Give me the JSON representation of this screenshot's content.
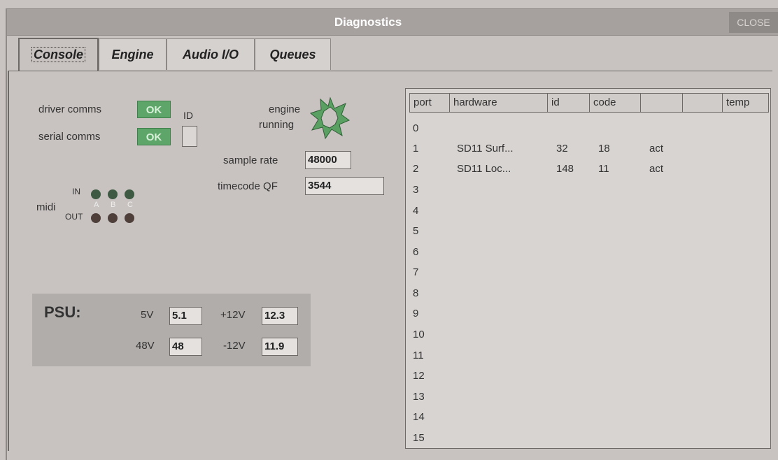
{
  "window": {
    "title": "Diagnostics",
    "close_label": "CLOSE"
  },
  "tabs": [
    {
      "label": "Console"
    },
    {
      "label": "Engine"
    },
    {
      "label": "Audio I/O"
    },
    {
      "label": "Queues"
    }
  ],
  "status": {
    "driver_comms_label": "driver comms",
    "driver_comms_value": "OK",
    "serial_comms_label": "serial comms",
    "serial_comms_value": "OK",
    "id_label": "ID",
    "engine_running_line1": "engine",
    "engine_running_line2": "running",
    "sample_rate_label": "sample rate",
    "sample_rate_value": "48000",
    "timecode_label": "timecode QF",
    "timecode_value": "3544"
  },
  "midi": {
    "label": "midi",
    "in_label": "IN",
    "out_label": "OUT",
    "channel_letters": [
      "A",
      "B",
      "C"
    ]
  },
  "psu": {
    "title": "PSU:",
    "v5_label": "5V",
    "v5_value": "5.1",
    "v12_label": "+12V",
    "v12_value": "12.3",
    "v48_label": "48V",
    "v48_value": "48",
    "vneg12_label": "-12V",
    "vneg12_value": "11.9"
  },
  "port_table": {
    "headers": [
      "port",
      "hardware",
      "id",
      "code",
      "",
      "",
      "temp"
    ],
    "rows": [
      {
        "port": "0",
        "hardware": "",
        "id": "",
        "code": "",
        "c5": ""
      },
      {
        "port": "1",
        "hardware": "SD11 Surf...",
        "id": "32",
        "code": "18",
        "c5": "act"
      },
      {
        "port": "2",
        "hardware": "SD11 Loc...",
        "id": "148",
        "code": "11",
        "c5": "act"
      },
      {
        "port": "3"
      },
      {
        "port": "4"
      },
      {
        "port": "5"
      },
      {
        "port": "6"
      },
      {
        "port": "7"
      },
      {
        "port": "8"
      },
      {
        "port": "9"
      },
      {
        "port": "10"
      },
      {
        "port": "11"
      },
      {
        "port": "12"
      },
      {
        "port": "13"
      },
      {
        "port": "14"
      },
      {
        "port": "15"
      }
    ]
  },
  "colors": {
    "ok_green": "#5ea56a",
    "midi_in": "#3e5a42",
    "midi_out": "#4e3f3a"
  }
}
